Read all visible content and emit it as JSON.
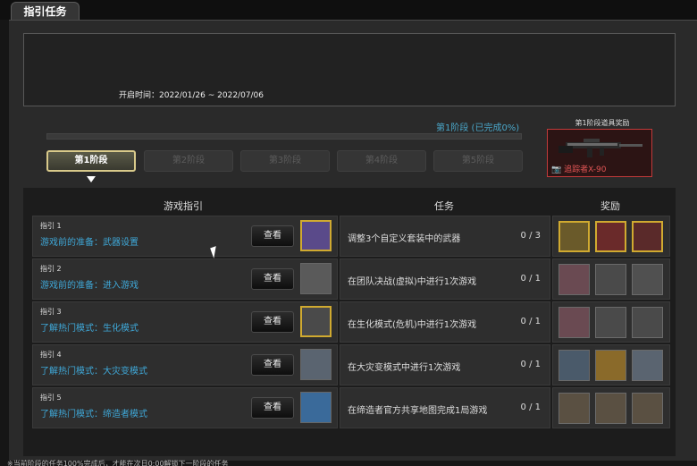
{
  "window": {
    "tab_label": "指引任务"
  },
  "info": {
    "time_label": "开启时间：2022/01/26 ~ 2022/07/06"
  },
  "stage": {
    "status": "第1阶段 (已完成0%)",
    "progress": 0,
    "tabs": [
      {
        "label": "第1阶段"
      },
      {
        "label": "第2阶段"
      },
      {
        "label": "第3阶段"
      },
      {
        "label": "第4阶段"
      },
      {
        "label": "第5阶段"
      }
    ]
  },
  "stage_reward": {
    "title": "第1阶段道具奖励",
    "item_name": "追踪者X-90"
  },
  "columns": {
    "guide": "游戏指引",
    "task": "任务",
    "reward": "奖励"
  },
  "view_label": "查看",
  "rows": [
    {
      "num": "指引 1",
      "title": "游戏前的准备：武器设置",
      "task": "调整3个自定义套装中的武器",
      "count": "0 / 3",
      "icon": "weapon-setting-icon",
      "icon_gold": true,
      "rewards": [
        {
          "icon": "gold-weapon-icon",
          "gold": true
        },
        {
          "icon": "red-weapon-icon",
          "gold": true
        },
        {
          "icon": "red-rifle-icon",
          "gold": true
        }
      ]
    },
    {
      "num": "指引 2",
      "title": "游戏前的准备：进入游戏",
      "task": "在团队决战(虚拟)中进行1次游戏",
      "count": "0 / 1",
      "icon": "enter-game-icon",
      "icon_gold": false,
      "rewards": [
        {
          "icon": "character-icon",
          "gold": false
        },
        {
          "icon": "rifle-icon",
          "gold": false
        },
        {
          "icon": "weapon-icon",
          "gold": false
        }
      ]
    },
    {
      "num": "指引 3",
      "title": "了解热门模式：生化模式",
      "task": "在生化模式(危机)中进行1次游戏",
      "count": "0 / 1",
      "icon": "zombie-mode-icon",
      "icon_gold": true,
      "rewards": [
        {
          "icon": "character-icon",
          "gold": false
        },
        {
          "icon": "rifle-icon",
          "gold": false
        },
        {
          "icon": "rifle-icon",
          "gold": false
        }
      ]
    },
    {
      "num": "指引 4",
      "title": "了解热门模式：大灾变模式",
      "task": "在大灾变模式中进行1次游戏",
      "count": "0 / 1",
      "icon": "hp-30-icon",
      "icon_gold": false,
      "rewards": [
        {
          "icon": "respawn-ticket-icon",
          "gold": false
        },
        {
          "icon": "trophy-icon",
          "gold": false
        },
        {
          "icon": "hp-100-icon",
          "gold": false
        }
      ]
    },
    {
      "num": "指引 5",
      "title": "了解热门模式：缔造者模式",
      "task": "在缔造者官方共享地图完成1局游戏",
      "count": "0 / 1",
      "icon": "maker-mode-icon",
      "icon_gold": false,
      "rewards": [
        {
          "icon": "voucher-icon",
          "gold": false
        },
        {
          "icon": "voucher-icon",
          "gold": false
        },
        {
          "icon": "voucher-icon",
          "gold": false
        }
      ]
    }
  ],
  "footer": {
    "note": "※当前阶段的任务100%完成后，才能在次日0:00解锁下一阶段的任务"
  }
}
